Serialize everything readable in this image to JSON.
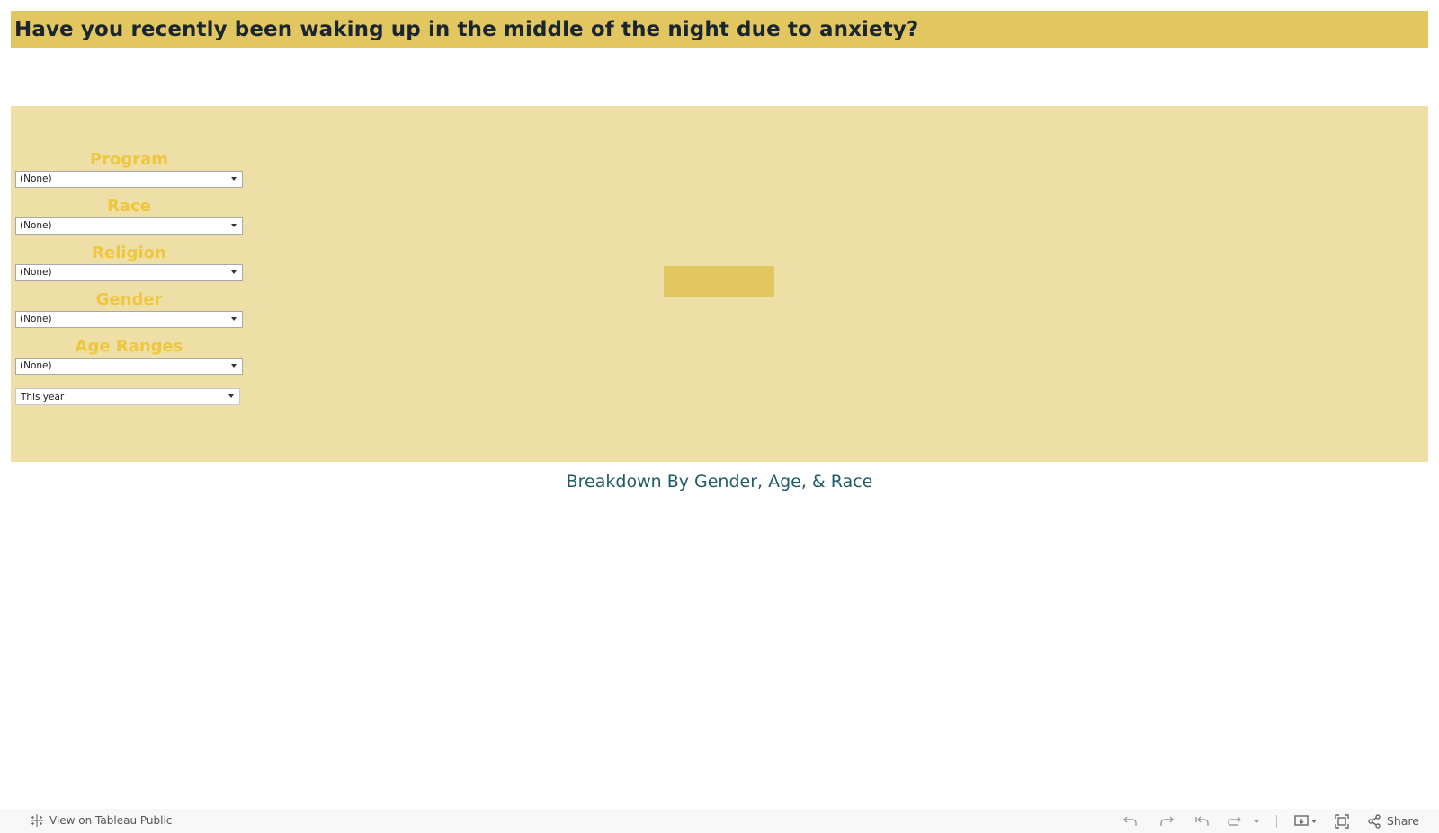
{
  "header": {
    "title": "Have you recently been waking up in the middle of the night due to anxiety?"
  },
  "filters": [
    {
      "label": "Program",
      "value": "(None)"
    },
    {
      "label": "Race",
      "value": "(None)"
    },
    {
      "label": "Religion",
      "value": "(None)"
    },
    {
      "label": "Gender",
      "value": "(None)"
    },
    {
      "label": "Age Ranges",
      "value": "(None)"
    }
  ],
  "date_filter": {
    "value": "This year"
  },
  "section": {
    "breakdown_title": "Breakdown By Gender, Age, & Race"
  },
  "footer": {
    "view_link": "View on Tableau Public",
    "share_label": "Share",
    "tools": {
      "undo": "undo-icon",
      "redo": "redo-icon",
      "revert": "revert-icon",
      "refresh": "refresh-icon",
      "download": "download-icon",
      "fullscreen": "fullscreen-icon",
      "share": "share-icon"
    }
  },
  "colors": {
    "title_bg": "#e2c760",
    "panel_bg": "#eddfa6",
    "filter_label": "#efc73f",
    "title_text": "#1b2530",
    "breakdown_text": "#1d5d63",
    "footer_bg": "#f8f8f8"
  }
}
